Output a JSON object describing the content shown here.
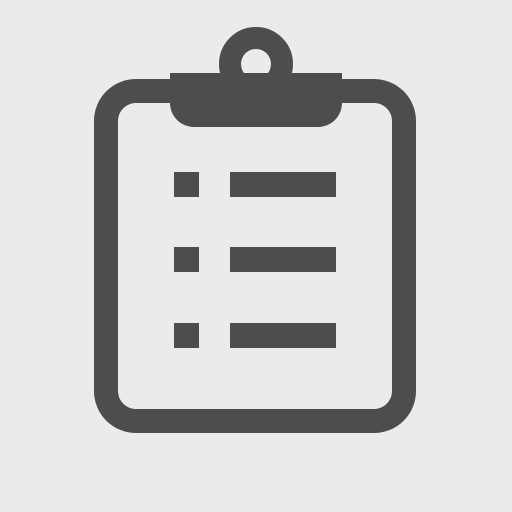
{
  "icon": {
    "name": "clipboard-checklist-icon",
    "background_color": "#ebebeb",
    "stroke_color": "#4d4d4d",
    "fill_color": "#4d4d4d",
    "inner_color": "#ebebeb",
    "list_item_count": 3
  }
}
